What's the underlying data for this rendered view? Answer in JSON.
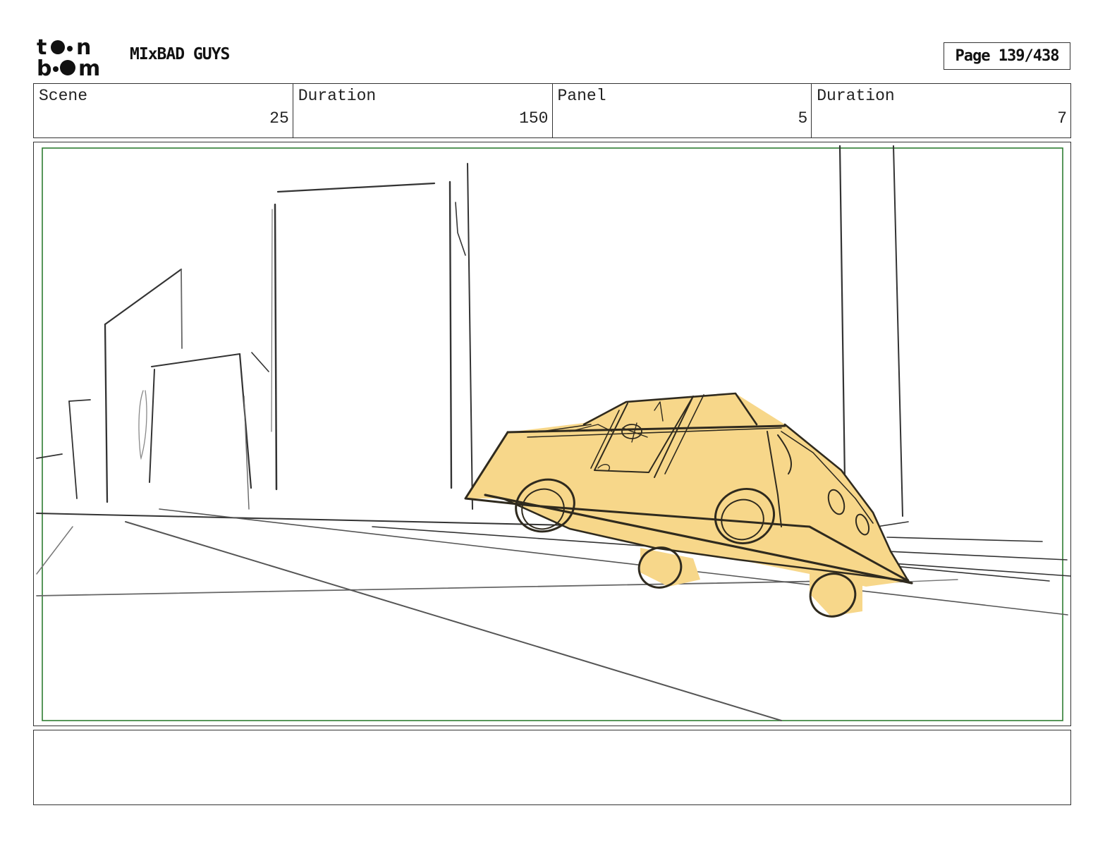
{
  "header": {
    "logo_text": "toon boom",
    "project_title": "MIxBAD GUYS",
    "page_label": "Page 139/438"
  },
  "info": {
    "scene_label": "Scene",
    "scene_value": "25",
    "scene_duration_label": "Duration",
    "scene_duration_value": "150",
    "panel_label": "Panel",
    "panel_value": "5",
    "panel_duration_label": "Duration",
    "panel_duration_value": "7"
  },
  "panel": {
    "safe_frame_color": "#2e7d32",
    "car_fill_color": "#f7d78a",
    "line_color": "#2b2b2b"
  },
  "notes": {
    "text": ""
  }
}
